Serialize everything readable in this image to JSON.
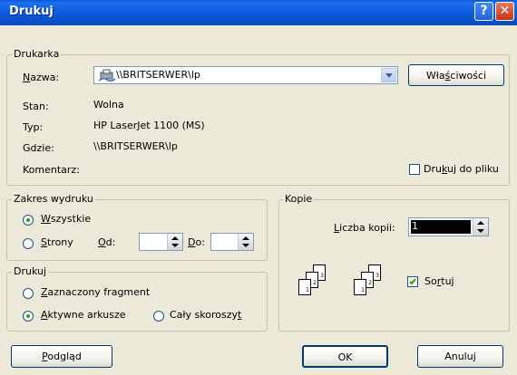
{
  "window": {
    "title": "Drukuj",
    "help_symbol": "?",
    "close_symbol": "✕"
  },
  "printer": {
    "legend": "Drukarka",
    "name_label_pre": "",
    "name_label_u": "N",
    "name_label_post": "azwa:",
    "name_value": "\\\\BRITSERWER\\lp",
    "properties_pre": "Wła",
    "properties_u": "ś",
    "properties_post": "ciwości",
    "status_label": "Stan:",
    "status_value": "Wolna",
    "type_label": "Typ:",
    "type_value": "HP LaserJet 1100 (MS)",
    "where_label": "Gdzie:",
    "where_value": "\\\\BRITSERWER\\lp",
    "comment_label": "Komentarz:",
    "print_to_file_pre": "Dru",
    "print_to_file_u": "k",
    "print_to_file_post": "uj do pliku",
    "print_to_file_checked": false
  },
  "range": {
    "legend": "Zakres wydruku",
    "all_pre": "",
    "all_u": "W",
    "all_post": "szystkie",
    "pages_pre": "",
    "pages_u": "S",
    "pages_post": "trony",
    "from_pre": "",
    "from_u": "O",
    "from_post": "d:",
    "from_value": "",
    "to_pre": "",
    "to_u": "D",
    "to_post": "o:",
    "to_value": "",
    "selected": "all"
  },
  "print_what": {
    "legend": "Drukuj",
    "selection_pre": "",
    "selection_u": "Z",
    "selection_post": "aznaczony fragment",
    "active_pre": "",
    "active_u": "A",
    "active_post": "ktywne arkusze",
    "workbook_pre": "Cały skoroszy",
    "workbook_u": "t",
    "workbook_post": "",
    "selected": "active"
  },
  "copies": {
    "legend": "Kopie",
    "count_pre": "",
    "count_u": "L",
    "count_post": "iczba kopii:",
    "count_value": "1",
    "collate_pre": "So",
    "collate_u": "r",
    "collate_post": "tuj",
    "collate_checked": true,
    "stack_labels": [
      "1",
      "2",
      "3"
    ]
  },
  "buttons": {
    "preview_pre": "",
    "preview_u": "P",
    "preview_post": "odgląd",
    "ok": "OK",
    "cancel": "Anuluj"
  },
  "colors": {
    "title_bar": "#0a5ad6",
    "dialog_bg": "#ece9d8",
    "selected_text_bg": "#000000"
  }
}
